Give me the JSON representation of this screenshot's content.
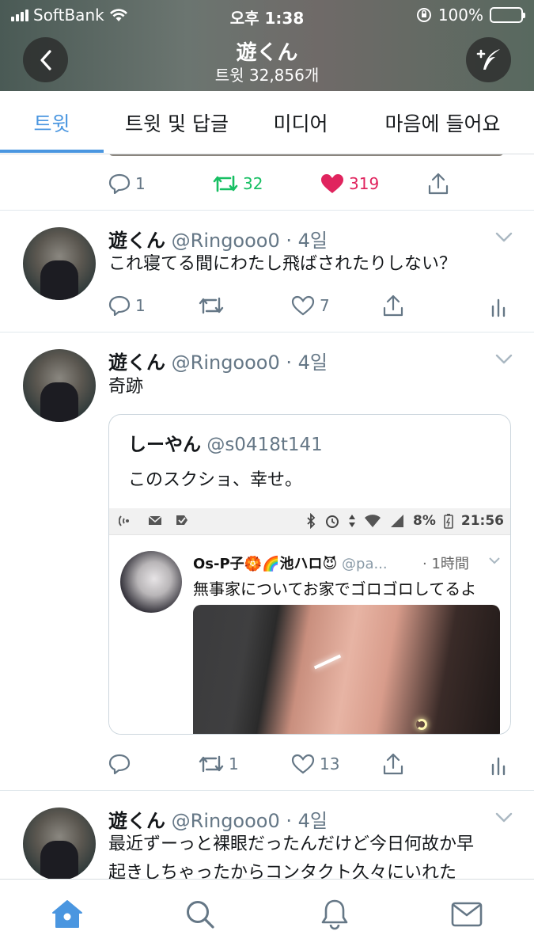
{
  "status_bar": {
    "carrier": "SoftBank",
    "time": "오후 1:38",
    "battery": "100%"
  },
  "header": {
    "title": "遊くん",
    "subtitle": "트윗 32,856개",
    "back_icon": "chevron-left-icon",
    "compose_icon": "compose-tweet-icon"
  },
  "tabs": [
    {
      "label": "트윗",
      "active": true
    },
    {
      "label": "트윗 및 답글",
      "active": false
    },
    {
      "label": "미디어",
      "active": false
    },
    {
      "label": "마음에 들어요",
      "active": false
    }
  ],
  "colors": {
    "accent": "#4a96e0",
    "retweet_green": "#17bf63",
    "like_red": "#e0245e",
    "muted": "#657786"
  },
  "partial_tweet": {
    "replies": "1",
    "retweets": "32",
    "likes": "319"
  },
  "tweets": [
    {
      "name": "遊くん",
      "handle": "@Ringooo0 · 4일",
      "text": "これ寝てる間にわたし飛ばされたりしない？",
      "replies": "1",
      "retweets": "",
      "likes": "7"
    },
    {
      "name": "遊くん",
      "handle": "@Ringooo0 · 4일",
      "text": "奇跡",
      "replies": "",
      "retweets": "1",
      "likes": "13",
      "quote": {
        "name": "しーやん",
        "handle": "@s0418t141",
        "text": "このスクショ、幸せ。",
        "screenshot": {
          "status_battery": "8%",
          "status_time": "21:56",
          "name": "Os-P子🏵️🌈池ハロ😈",
          "handle": "@pa...",
          "time": "· 1時間",
          "text": "無事家についてお家でゴロゴロしてるよ"
        }
      }
    },
    {
      "name": "遊くん",
      "handle": "@Ringooo0 · 4일",
      "text_line1": "最近ずーっと裸眼だったんだけど今日何故か早",
      "text_line2": "起きしちゃったからコンタクト久々にいれた"
    }
  ],
  "bottom_nav": [
    {
      "icon": "home-icon",
      "active": true
    },
    {
      "icon": "search-icon",
      "active": false
    },
    {
      "icon": "notifications-bell-icon",
      "active": false
    },
    {
      "icon": "messages-envelope-icon",
      "active": false
    }
  ]
}
